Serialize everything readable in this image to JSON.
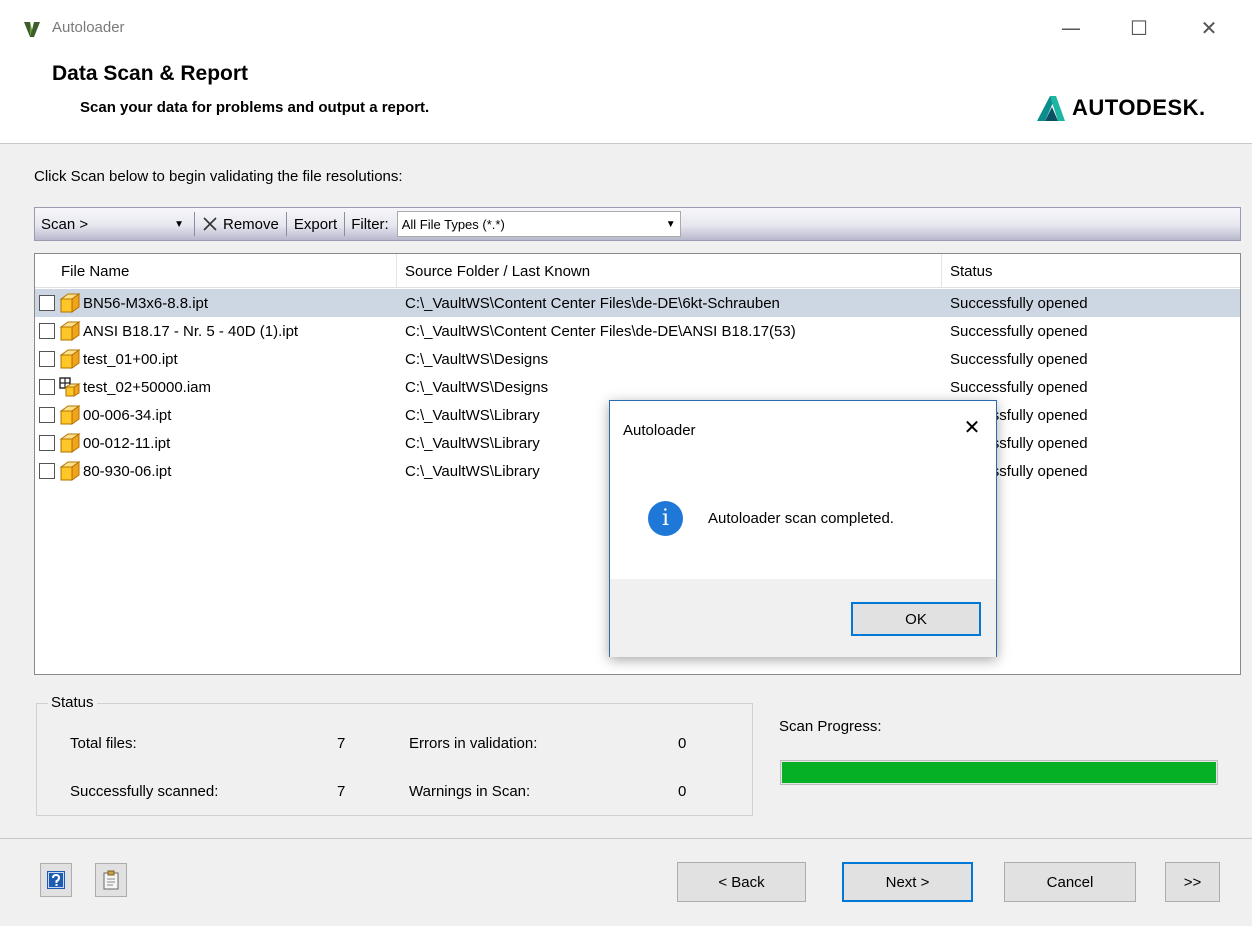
{
  "window": {
    "title": "Autoloader",
    "controls": [
      "—",
      "☐",
      "✕"
    ]
  },
  "header": {
    "title": "Data Scan & Report",
    "subtitle": "Scan your data for problems and output a report.",
    "brand": "AUTODESK."
  },
  "instruction": "Click Scan below to begin validating the file resolutions:",
  "toolbar": {
    "scan_label": "Scan >",
    "remove_label": "Remove",
    "export_label": "Export",
    "filter_label": "Filter:",
    "filter_value": "All File Types (*.*)"
  },
  "table": {
    "columns": [
      "File Name",
      "Source Folder / Last Known",
      "Status"
    ],
    "rows": [
      {
        "name": "BN56-M3x6-8.8.ipt",
        "folder": "C:\\_VaultWS\\Content Center Files\\de-DE\\6kt-Schrauben",
        "status": "Successfully opened",
        "icon": "part-icon",
        "selected": true
      },
      {
        "name": "ANSI B18.17 - Nr. 5 - 40D (1).ipt",
        "folder": "C:\\_VaultWS\\Content Center Files\\de-DE\\ANSI B18.17(53)",
        "status": "Successfully opened",
        "icon": "part-icon"
      },
      {
        "name": "test_01+00.ipt",
        "folder": "C:\\_VaultWS\\Designs",
        "status": "Successfully opened",
        "icon": "part-icon"
      },
      {
        "name": "test_02+50000.iam",
        "folder": "C:\\_VaultWS\\Designs",
        "status": "Successfully opened",
        "icon": "assembly-icon"
      },
      {
        "name": "00-006-34.ipt",
        "folder": "C:\\_VaultWS\\Library",
        "status": "Successfully opened",
        "icon": "part-icon"
      },
      {
        "name": "00-012-11.ipt",
        "folder": "C:\\_VaultWS\\Library",
        "status": "Successfully opened",
        "icon": "part-icon"
      },
      {
        "name": "80-930-06.ipt",
        "folder": "C:\\_VaultWS\\Library",
        "status": "Successfully opened",
        "icon": "part-icon"
      }
    ]
  },
  "status": {
    "legend": "Status",
    "total_files_label": "Total files:",
    "total_files": "7",
    "scanned_label": "Successfully scanned:",
    "scanned": "7",
    "errors_label": "Errors in validation:",
    "errors": "0",
    "warnings_label": "Warnings in Scan:",
    "warnings": "0"
  },
  "progress": {
    "label": "Scan Progress:",
    "percent": 100,
    "color": "#06b025"
  },
  "footer": {
    "back_label": "< Back",
    "next_label": "Next >",
    "cancel_label": "Cancel",
    "more_label": ">>"
  },
  "dialog": {
    "title": "Autoloader",
    "message": "Autoloader scan completed.",
    "ok_label": "OK"
  },
  "colors": {
    "accent": "#0078d7",
    "selection": "#cdd7e3",
    "info": "#1e78d7"
  }
}
